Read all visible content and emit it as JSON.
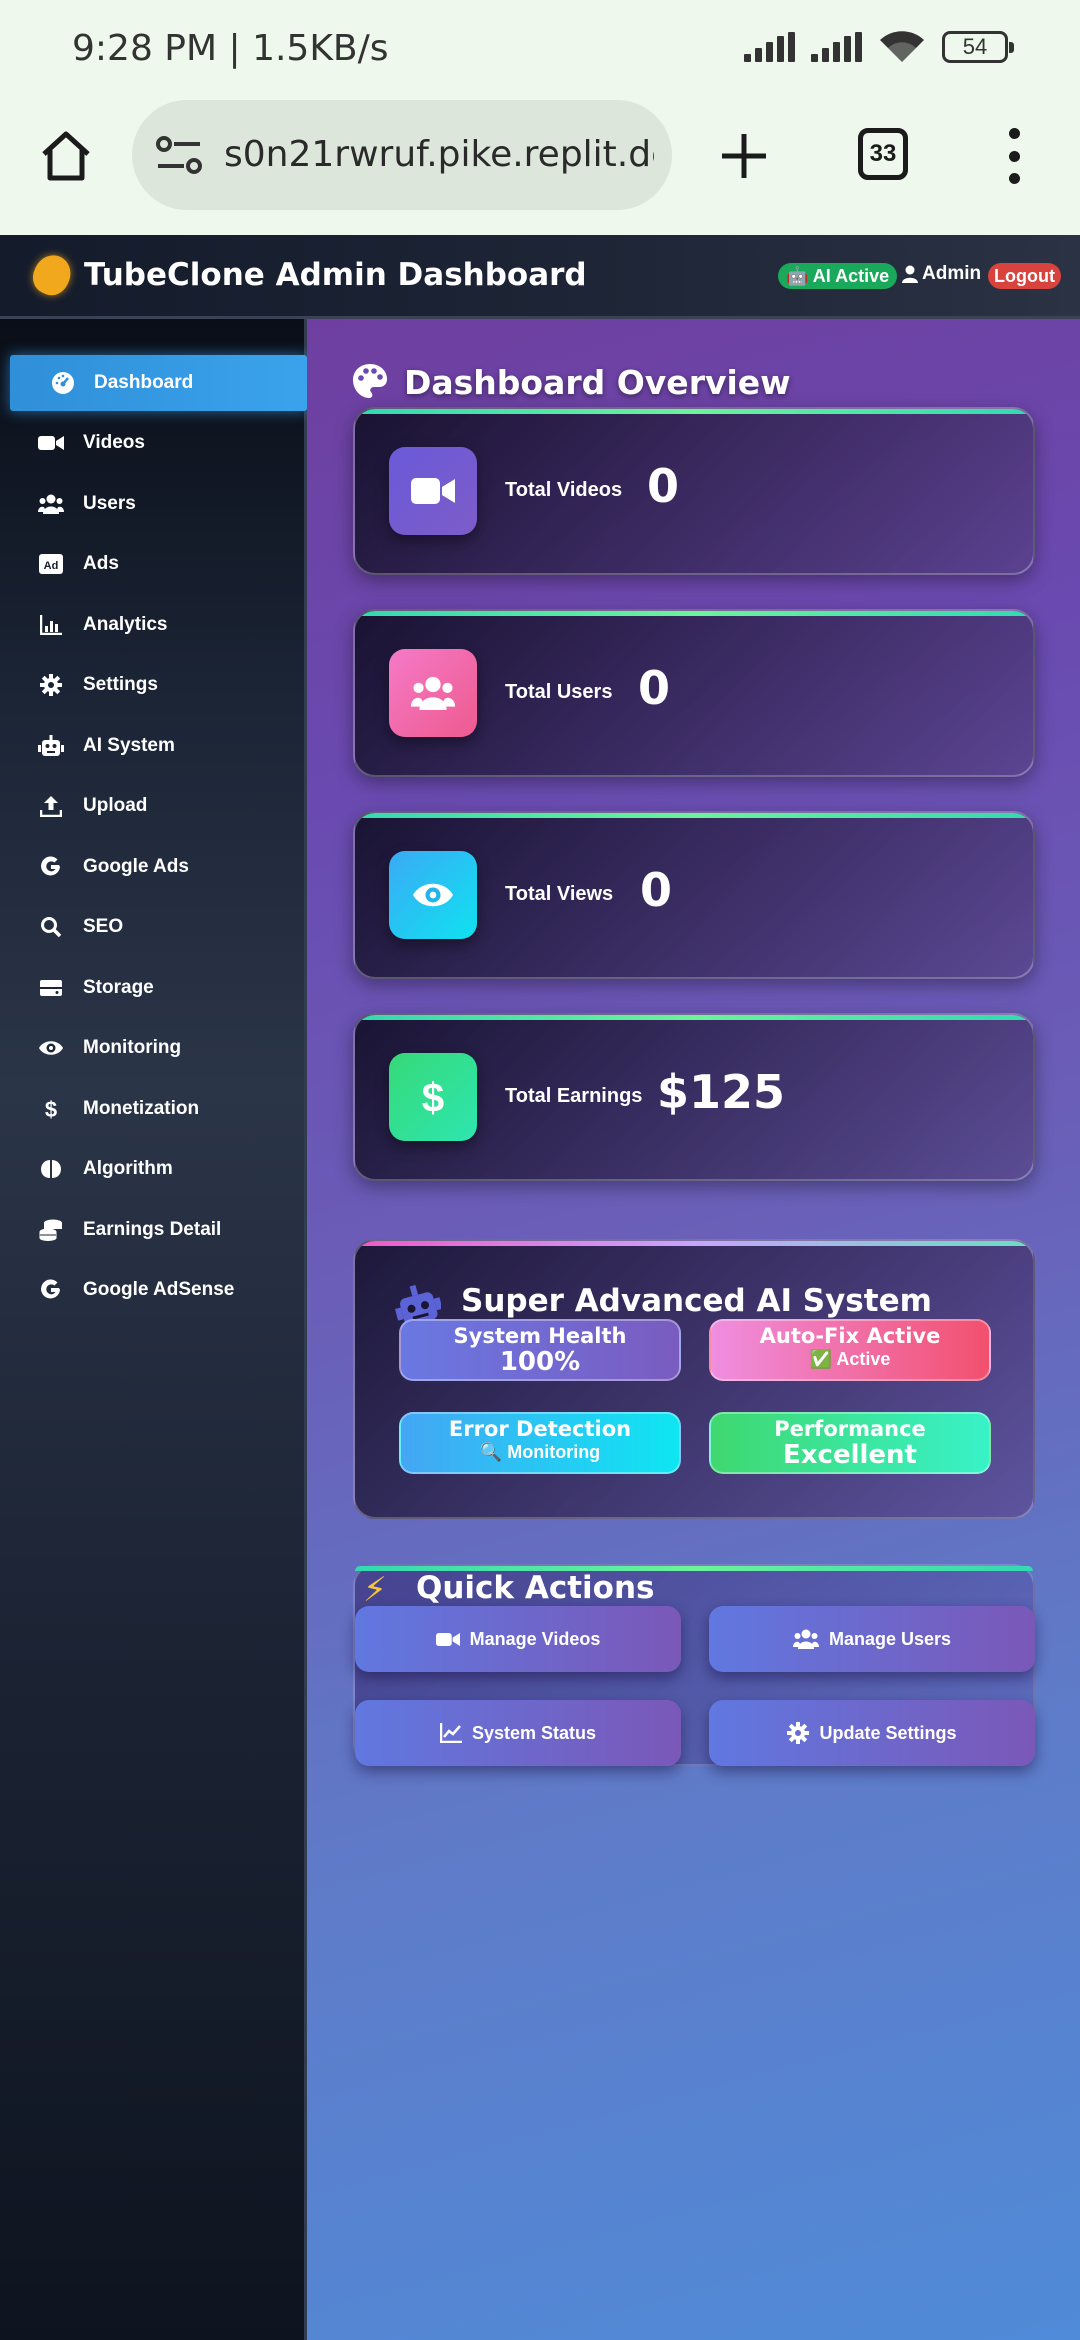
{
  "status_bar": {
    "time": "9:28 PM | 1.5KB/s",
    "battery": "54"
  },
  "browser": {
    "url": "s0n21rwruf.pike.replit.dev",
    "tab_count": "33"
  },
  "header": {
    "title": "TubeClone Admin Dashboard",
    "ai_badge": "🤖 AI Active",
    "admin_label": "Admin",
    "logout_label": "Logout"
  },
  "sidebar": {
    "items": [
      {
        "label": "Dashboard",
        "icon": "dashboard-gauge-icon"
      },
      {
        "label": "Videos",
        "icon": "video-camera-icon"
      },
      {
        "label": "Users",
        "icon": "users-icon"
      },
      {
        "label": "Ads",
        "icon": "ad-icon"
      },
      {
        "label": "Analytics",
        "icon": "bar-chart-icon"
      },
      {
        "label": "Settings",
        "icon": "gear-icon"
      },
      {
        "label": "AI System",
        "icon": "robot-icon"
      },
      {
        "label": "Upload",
        "icon": "upload-icon"
      },
      {
        "label": "Google Ads",
        "icon": "google-icon"
      },
      {
        "label": "SEO",
        "icon": "search-icon"
      },
      {
        "label": "Storage",
        "icon": "hdd-icon"
      },
      {
        "label": "Monitoring",
        "icon": "eye-icon"
      },
      {
        "label": "Monetization",
        "icon": "dollar-icon"
      },
      {
        "label": "Algorithm",
        "icon": "brain-icon"
      },
      {
        "label": "Earnings Detail",
        "icon": "coins-icon"
      },
      {
        "label": "Google AdSense",
        "icon": "google-icon"
      }
    ],
    "active_index": 0
  },
  "main": {
    "overview_title": "Dashboard Overview",
    "stats": [
      {
        "label": "Total Videos",
        "value": "0"
      },
      {
        "label": "Total Users",
        "value": "0"
      },
      {
        "label": "Total Views",
        "value": "0"
      },
      {
        "label": "Total Earnings",
        "value": "$125"
      }
    ],
    "ai_system": {
      "title": "Super Advanced AI System",
      "tiles": [
        {
          "title": "System Health",
          "value": "100%"
        },
        {
          "title": "Auto-Fix Active",
          "value": "✅ Active"
        },
        {
          "title": "Error Detection",
          "value": "🔍 Monitoring"
        },
        {
          "title": "Performance",
          "value": "Excellent"
        }
      ]
    },
    "quick_actions": {
      "title": "Quick Actions",
      "buttons": [
        {
          "label": "Manage Videos"
        },
        {
          "label": "Manage Users"
        },
        {
          "label": "System Status"
        },
        {
          "label": "Update Settings"
        }
      ]
    }
  },
  "colors": {
    "accent": "#3aa3ec",
    "stat_videos": "#6a5ad8",
    "stat_users": "#f06ab4",
    "stat_views": "#1fc8f0",
    "stat_earnings": "#2ee08a",
    "logout": "#d8433d",
    "ai_active": "#1aa95a"
  }
}
